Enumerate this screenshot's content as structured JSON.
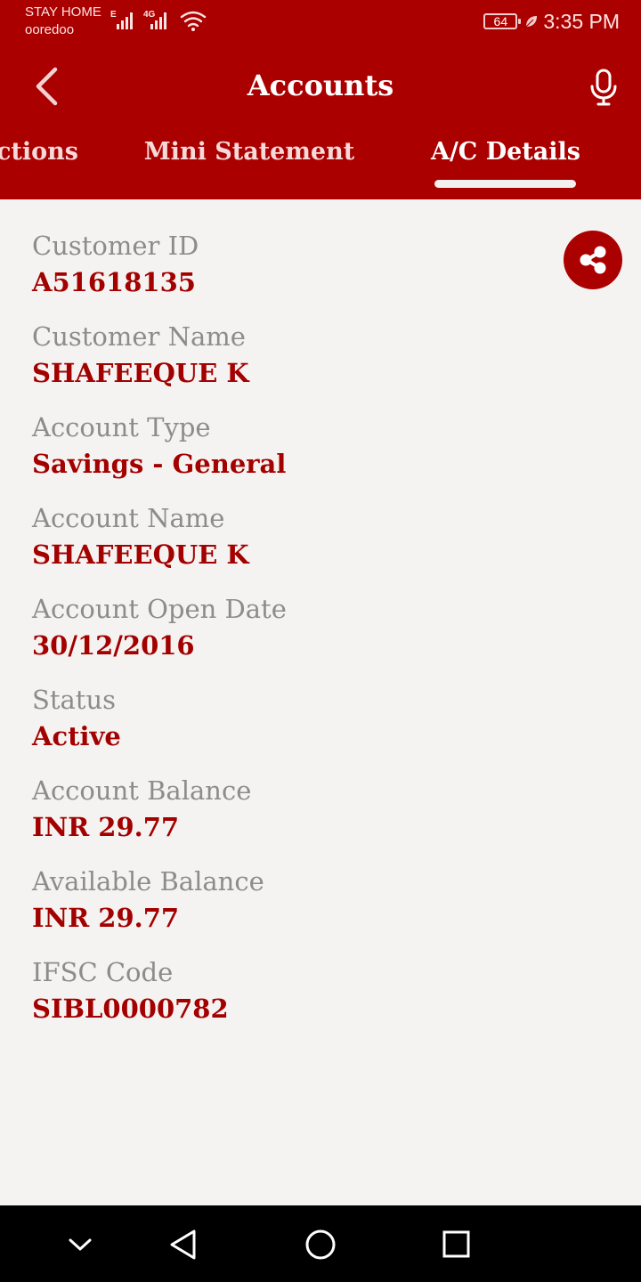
{
  "status_bar": {
    "carrier_line1": "STAY HOME",
    "carrier_line2": "ooredoo",
    "network_e": "E",
    "network_4g": "4G",
    "battery": "64",
    "time": "3:35 PM",
    "icons": [
      "signal-icon",
      "wifi-icon",
      "battery-icon",
      "leaf-icon"
    ]
  },
  "header": {
    "title": "Accounts",
    "icons": [
      "back-icon",
      "mic-icon"
    ]
  },
  "tabs": [
    {
      "label": "Transactions",
      "visible_text": "ctions"
    },
    {
      "label": "Mini Statement"
    },
    {
      "label": "A/C Details",
      "active": true
    }
  ],
  "details": [
    {
      "label": "Customer ID",
      "value": "A51618135"
    },
    {
      "label": "Customer Name",
      "value": "SHAFEEQUE K"
    },
    {
      "label": "Account Type",
      "value": "Savings - General"
    },
    {
      "label": "Account Name",
      "value": "SHAFEEQUE K"
    },
    {
      "label": "Account Open Date",
      "value": "30/12/2016"
    },
    {
      "label": "Status",
      "value": "Active"
    },
    {
      "label": "Account Balance",
      "value": "INR 29.77"
    },
    {
      "label": "Available Balance",
      "value": "INR 29.77"
    },
    {
      "label": "IFSC Code",
      "value": "SIBL0000782"
    }
  ],
  "share_icon": "share-icon",
  "nav_bar": [
    "chevron-down-icon",
    "back-triangle-icon",
    "home-circle-icon",
    "recents-square-icon"
  ],
  "colors": {
    "brand": "#ab0000",
    "value_text": "#a30000",
    "label_text": "#8c8c8c",
    "background": "#f5f3f1"
  }
}
